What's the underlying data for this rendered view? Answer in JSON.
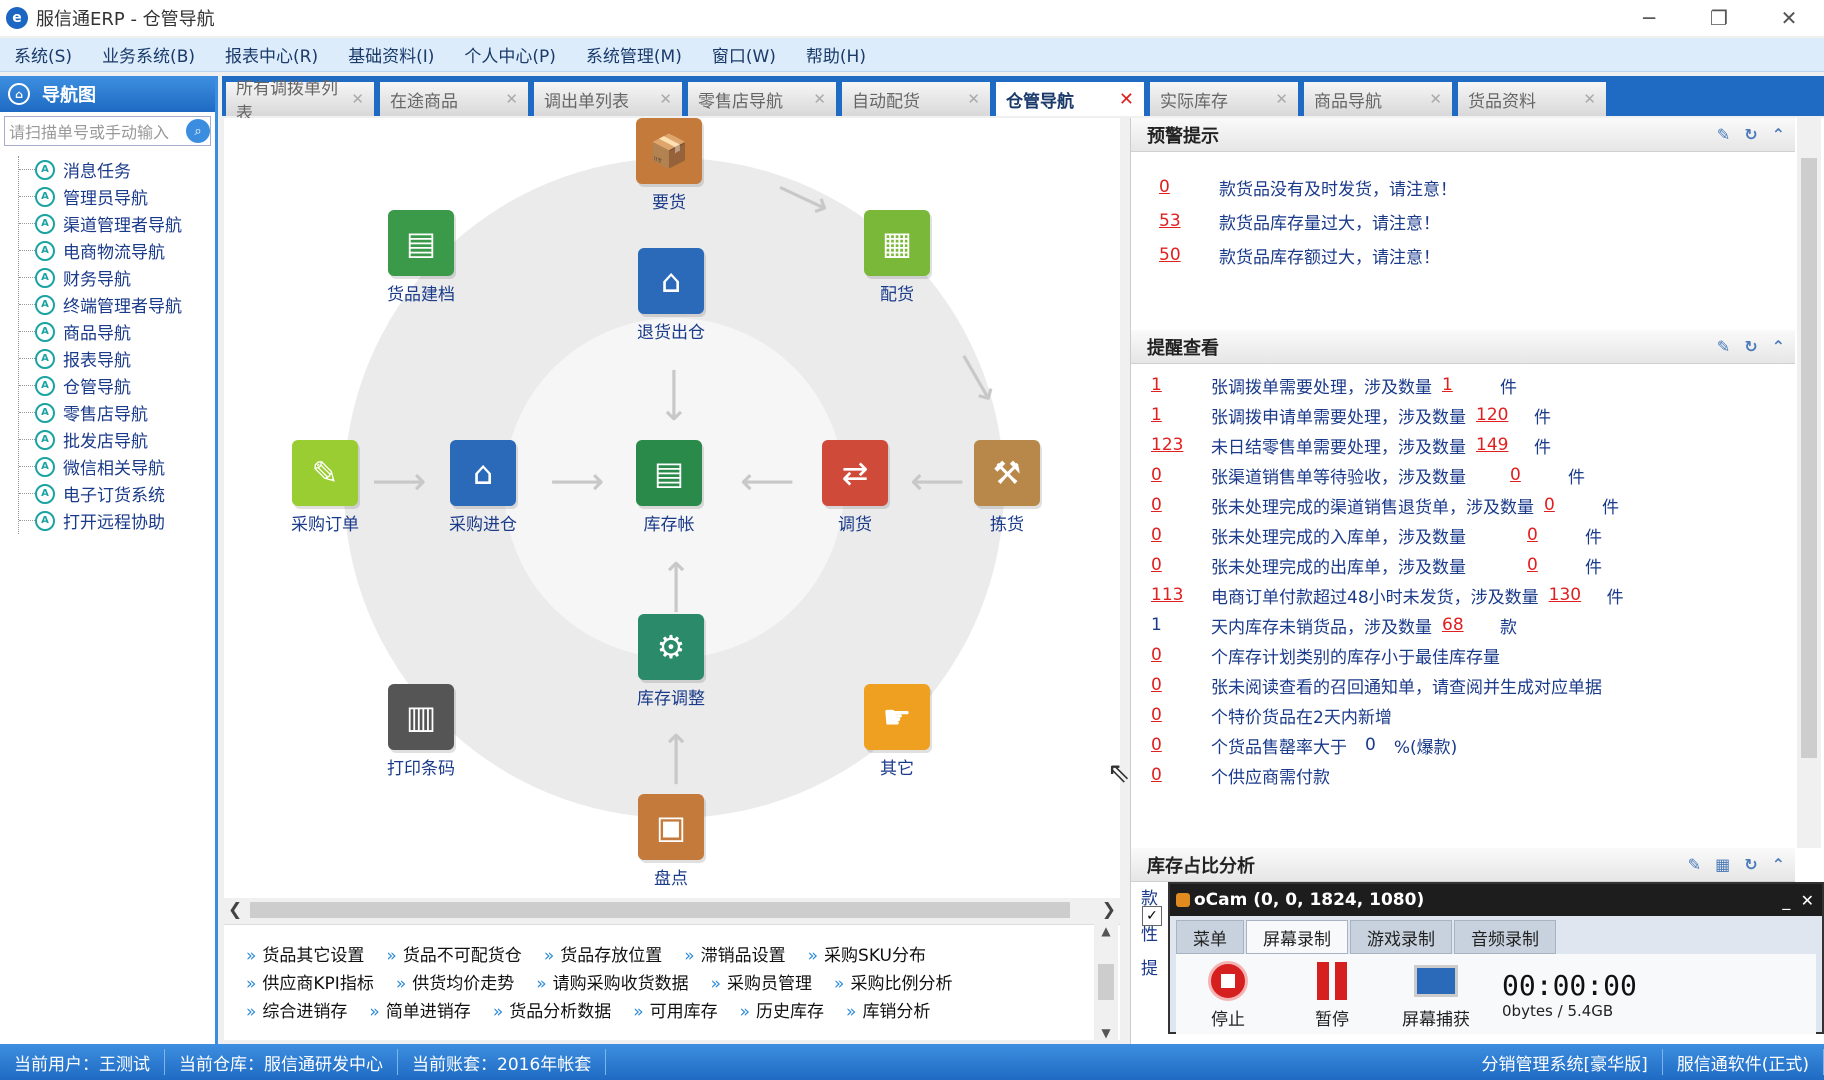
{
  "window": {
    "title": "服信通ERP - 仓管导航",
    "logo": "e"
  },
  "menu": [
    "系统(S)",
    "业务系统(B)",
    "报表中心(R)",
    "基础资料(I)",
    "个人中心(P)",
    "系统管理(M)",
    "窗口(W)",
    "帮助(H)"
  ],
  "nav": {
    "header": "导航图",
    "search_placeholder": "请扫描单号或手动输入",
    "items": [
      "消息任务",
      "管理员导航",
      "渠道管理者导航",
      "电商物流导航",
      "财务导航",
      "终端管理者导航",
      "商品导航",
      "报表导航",
      "仓管导航",
      "零售店导航",
      "批发店导航",
      "微信相关导航",
      "电子订货系统",
      "打开远程协助"
    ]
  },
  "tabs": [
    {
      "label": "所有调拨单列表",
      "active": false
    },
    {
      "label": "在途商品",
      "active": false
    },
    {
      "label": "调出单列表",
      "active": false
    },
    {
      "label": "零售店导航",
      "active": false
    },
    {
      "label": "自动配货",
      "active": false
    },
    {
      "label": "仓管导航",
      "active": true
    },
    {
      "label": "实际库存",
      "active": false
    },
    {
      "label": "商品导航",
      "active": false
    },
    {
      "label": "货品资料",
      "active": false
    }
  ],
  "diagram": {
    "nodes": {
      "yaohuo": {
        "label": "要货",
        "icon": "box-request-icon",
        "color": "#c47a3a"
      },
      "huopinjiandang": {
        "label": "货品建档",
        "icon": "ledger-icon",
        "color": "#3a9a4a"
      },
      "peihuo": {
        "label": "配货",
        "icon": "distribution-icon",
        "color": "#7ab83a"
      },
      "tuihuochucang": {
        "label": "退货出仓",
        "icon": "warehouse-return-icon",
        "color": "#2a6ab8"
      },
      "caigoudingdan": {
        "label": "采购订单",
        "icon": "order-note-icon",
        "color": "#9acd32"
      },
      "caigoujincang": {
        "label": "采购进仓",
        "icon": "warehouse-in-icon",
        "color": "#2a6ab8"
      },
      "kucunzhang": {
        "label": "库存帐",
        "icon": "stock-ledger-icon",
        "color": "#2a8a4a"
      },
      "diaohuo": {
        "label": "调货",
        "icon": "transfer-icon",
        "color": "#d04a3a"
      },
      "jianhuo": {
        "label": "拣货",
        "icon": "picking-icon",
        "color": "#b8884a"
      },
      "kucuntiaozheng": {
        "label": "库存调整",
        "icon": "stock-adjust-icon",
        "color": "#2a8a6a"
      },
      "dayintiaoma": {
        "label": "打印条码",
        "icon": "barcode-printer-icon",
        "color": "#555555"
      },
      "qita": {
        "label": "其它",
        "icon": "pointing-hand-icon",
        "color": "#f0a020"
      },
      "pandian": {
        "label": "盘点",
        "icon": "inventory-count-icon",
        "color": "#c47a3a"
      }
    }
  },
  "bottom_links": [
    [
      "货品其它设置",
      "货品不可配货仓",
      "货品存放位置",
      "滞销品设置",
      "采购SKU分布"
    ],
    [
      "供应商KPI指标",
      "供货均价走势",
      "请购采购收货数据",
      "采购员管理",
      "采购比例分析"
    ],
    [
      "综合进销存",
      "简单进销存",
      "货品分析数据",
      "可用库存",
      "历史库存",
      "库销分析"
    ]
  ],
  "warning": {
    "title": "预警提示",
    "rows": [
      {
        "count": "0",
        "text": "款货品没有及时发货，请注意！"
      },
      {
        "count": "53",
        "text": "款货品库存量过大，请注意！"
      },
      {
        "count": "50",
        "text": "款货品库存额过大，请注意！"
      }
    ]
  },
  "reminder": {
    "title": "提醒查看",
    "rows": [
      {
        "n": "1",
        "text": "张调拨单需要处理，涉及数量",
        "qty": "1",
        "unit": "件",
        "blue": false
      },
      {
        "n": "1",
        "text": "张调拨申请单需要处理，涉及数量",
        "qty": "120",
        "unit": "件",
        "blue": false
      },
      {
        "n": "123",
        "text": "未日结零售单需要处理，涉及数量",
        "qty": "149",
        "unit": "件",
        "blue": false
      },
      {
        "n": "0",
        "text": "张渠道销售单等待验收，涉及数量　　",
        "qty": "0",
        "unit": "件",
        "blue": false
      },
      {
        "n": "0",
        "text": "张未处理完成的渠道销售退货单，涉及数量",
        "qty": "0",
        "unit": "件",
        "blue": false
      },
      {
        "n": "0",
        "text": "张未处理完成的入库单，涉及数量　　　",
        "qty": "0",
        "unit": "件",
        "blue": false
      },
      {
        "n": "0",
        "text": "张未处理完成的出库单，涉及数量　　　",
        "qty": "0",
        "unit": "件",
        "blue": false
      },
      {
        "n": "113",
        "text": "电商订单付款超过48小时未发货，涉及数量",
        "qty": "130",
        "unit": "件",
        "blue": false
      },
      {
        "n": "1",
        "text": "天内库存未销货品，涉及数量",
        "qty": "68",
        "unit": "款",
        "blue": true
      },
      {
        "n": "0",
        "text": "个库存计划类别的库存小于最佳库存量",
        "qty": "",
        "unit": "",
        "blue": false
      },
      {
        "n": "0",
        "text": "张未阅读查看的召回通知单，请查阅并生成对应单据",
        "qty": "",
        "unit": "",
        "blue": false
      },
      {
        "n": "0",
        "text": "个特价货品在2天内新增",
        "qty": "",
        "unit": "",
        "blue": false
      },
      {
        "n": "0",
        "text": "个货品售罄率大于",
        "qty": "",
        "unit": "",
        "blue": false,
        "pct_val": "0",
        "pct_txt": "%(爆款)"
      },
      {
        "n": "0",
        "text": "个供应商需付款",
        "qty": "",
        "unit": "",
        "blue": false
      }
    ]
  },
  "stock_panel": {
    "title": "库存占比分析",
    "side_chars": [
      "款",
      "性",
      "提"
    ]
  },
  "status": {
    "user": "当前用户：王测试",
    "warehouse": "当前仓库：服信通研发中心",
    "account": "当前账套：2016年帐套",
    "system": "分销管理系统[豪华版]",
    "company": "服信通软件(正式)"
  },
  "ocam": {
    "title": "oCam (0, 0, 1824, 1080)",
    "tabs": [
      "菜单",
      "屏幕录制",
      "游戏录制",
      "音频录制"
    ],
    "active_tab": 1,
    "buttons": [
      "停止",
      "暂停",
      "屏幕捕获"
    ],
    "time": "00:00:00",
    "size": "0bytes / 5.4GB"
  },
  "colors": {
    "accent": "#1f6bc4",
    "alert": "#e02020",
    "link": "#1a3a8a"
  }
}
